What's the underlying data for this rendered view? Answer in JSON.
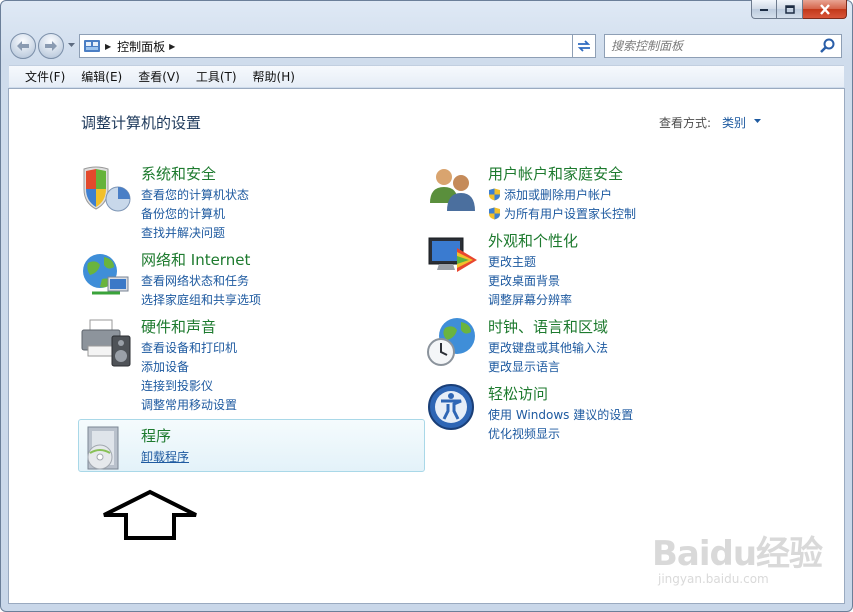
{
  "window": {
    "caption_buttons": [
      "minimize-icon",
      "maximize-icon",
      "close-icon"
    ]
  },
  "navigation": {
    "breadcrumb": "控制面板",
    "search_placeholder": "搜索控制面板"
  },
  "menubar": {
    "items": [
      "文件(F)",
      "编辑(E)",
      "查看(V)",
      "工具(T)",
      "帮助(H)"
    ]
  },
  "content": {
    "title": "调整计算机的设置",
    "view_by_label": "查看方式:",
    "view_by_value": "类别"
  },
  "categories": {
    "system": {
      "icon": "shield-icon",
      "title": "系统和安全",
      "links": [
        "查看您的计算机状态",
        "备份您的计算机",
        "查找并解决问题"
      ]
    },
    "network": {
      "icon": "globe-network-icon",
      "title": "网络和 Internet",
      "links": [
        "查看网络状态和任务",
        "选择家庭组和共享选项"
      ]
    },
    "hardware": {
      "icon": "printer-icon",
      "title": "硬件和声音",
      "links": [
        "查看设备和打印机",
        "添加设备",
        "连接到投影仪",
        "调整常用移动设置"
      ]
    },
    "programs": {
      "icon": "programs-icon",
      "title": "程序",
      "links": [
        "卸载程序"
      ]
    },
    "users": {
      "icon": "users-icon",
      "title": "用户帐户和家庭安全",
      "links": [
        "添加或删除用户帐户",
        "为所有用户设置家长控制"
      ]
    },
    "appearance": {
      "icon": "monitor-color-icon",
      "title": "外观和个性化",
      "links": [
        "更改主题",
        "更改桌面背景",
        "调整屏幕分辨率"
      ]
    },
    "clock": {
      "icon": "clock-globe-icon",
      "title": "时钟、语言和区域",
      "links": [
        "更改键盘或其他输入法",
        "更改显示语言"
      ]
    },
    "ease": {
      "icon": "ease-of-access-icon",
      "title": "轻松访问",
      "links": [
        "使用 Windows 建议的设置",
        "优化视频显示"
      ]
    }
  },
  "watermark": {
    "brand": "Baidu经验",
    "url": "jingyan.baidu.com"
  },
  "colors": {
    "category_title": "#1d7a2e",
    "link": "#1e5aa0",
    "page_title": "#1e395b"
  }
}
